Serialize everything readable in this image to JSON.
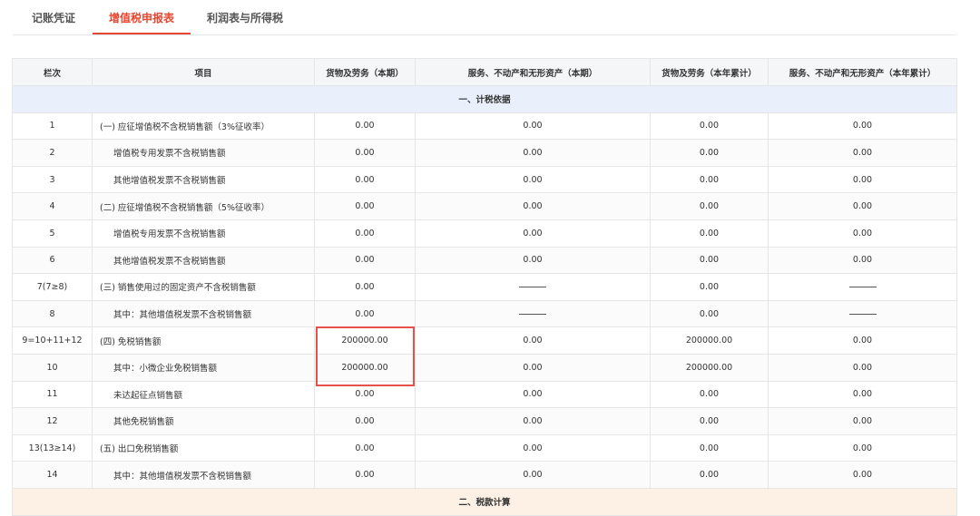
{
  "tabs": [
    {
      "label": "记账凭证"
    },
    {
      "label": "增值税申报表"
    },
    {
      "label": "利润表与所得税"
    }
  ],
  "table": {
    "headers": [
      "栏次",
      "项目",
      "货物及劳务（本期）",
      "服务、不动产和无形资产（本期）",
      "货物及劳务（本年累计）",
      "服务、不动产和无形资产（本年累计）"
    ],
    "section1": "一、计税依据",
    "section2": "二、税款计算",
    "rows": [
      {
        "no": "1",
        "item": "(一) 应征增值税不含税销售额（3%征收率）",
        "c1": "0.00",
        "c2": "0.00",
        "c3": "0.00",
        "c4": "0.00"
      },
      {
        "no": "2",
        "item": "增值税专用发票不含税销售额",
        "c1": "0.00",
        "c2": "0.00",
        "c3": "0.00",
        "c4": "0.00"
      },
      {
        "no": "3",
        "item": "其他增值税发票不含税销售额",
        "c1": "0.00",
        "c2": "0.00",
        "c3": "0.00",
        "c4": "0.00"
      },
      {
        "no": "4",
        "item": "(二) 应征增值税不含税销售额（5%征收率）",
        "c1": "0.00",
        "c2": "0.00",
        "c3": "0.00",
        "c4": "0.00"
      },
      {
        "no": "5",
        "item": "增值税专用发票不含税销售额",
        "c1": "0.00",
        "c2": "0.00",
        "c3": "0.00",
        "c4": "0.00"
      },
      {
        "no": "6",
        "item": "其他增值税发票不含税销售额",
        "c1": "0.00",
        "c2": "0.00",
        "c3": "0.00",
        "c4": "0.00"
      },
      {
        "no": "7(7≥8)",
        "item": "(三) 销售使用过的固定资产不含税销售额",
        "c1": "0.00",
        "c2": "",
        "c3": "0.00",
        "c4": ""
      },
      {
        "no": "8",
        "item": "其中：其他增值税发票不含税销售额",
        "c1": "0.00",
        "c2": "",
        "c3": "0.00",
        "c4": ""
      },
      {
        "no": "9=10+11+12",
        "item": "(四) 免税销售额",
        "c1": "200000.00",
        "c2": "0.00",
        "c3": "200000.00",
        "c4": "0.00"
      },
      {
        "no": "10",
        "item": "其中：小微企业免税销售额",
        "c1": "200000.00",
        "c2": "0.00",
        "c3": "200000.00",
        "c4": "0.00"
      },
      {
        "no": "11",
        "item": "未达起征点销售额",
        "c1": "0.00",
        "c2": "0.00",
        "c3": "0.00",
        "c4": "0.00"
      },
      {
        "no": "12",
        "item": "其他免税销售额",
        "c1": "0.00",
        "c2": "0.00",
        "c3": "0.00",
        "c4": "0.00"
      },
      {
        "no": "13(13≥14)",
        "item": "(五) 出口免税销售额",
        "c1": "0.00",
        "c2": "0.00",
        "c3": "0.00",
        "c4": "0.00"
      },
      {
        "no": "14",
        "item": "其中：其他增值税发票不含税销售额",
        "c1": "0.00",
        "c2": "0.00",
        "c3": "0.00",
        "c4": "0.00"
      }
    ]
  }
}
